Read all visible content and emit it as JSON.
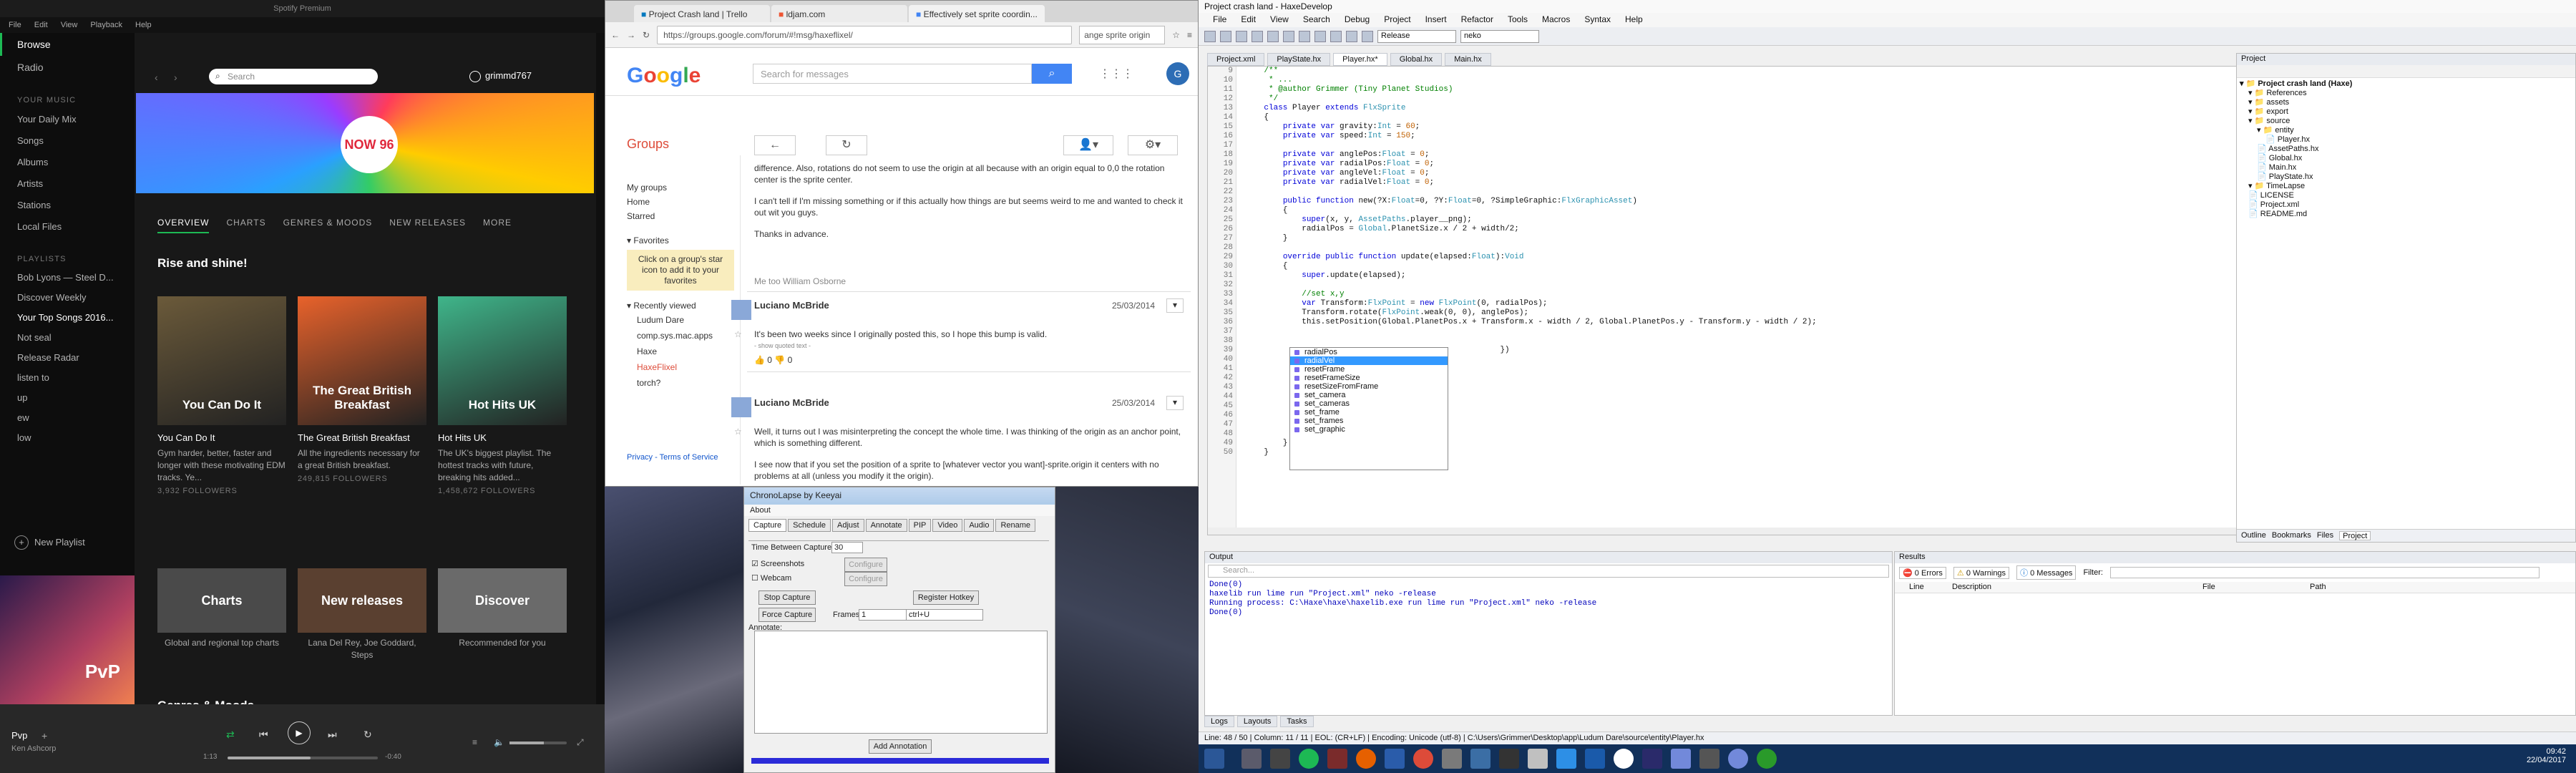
{
  "spotify": {
    "title": "Spotify Premium",
    "menu": [
      "File",
      "Edit",
      "View",
      "Playback",
      "Help"
    ],
    "nav": [
      {
        "label": "Browse",
        "on": true
      },
      {
        "label": "Radio",
        "on": false
      }
    ],
    "library_header": "YOUR MUSIC",
    "library": [
      "Your Daily Mix",
      "Songs",
      "Albums",
      "Artists",
      "Stations",
      "Local Files"
    ],
    "playlists_header": "PLAYLISTS",
    "playlists": [
      "Bob Lyons — Steel D...",
      "Discover Weekly",
      "Your Top Songs 2016...",
      "Not seal",
      "Release Radar",
      "listen to",
      "up",
      "ew",
      "low"
    ],
    "new_playlist": "New Playlist",
    "search_placeholder": "Search",
    "user": "grimmd767",
    "banner_badge": "NOW 96",
    "tabs": [
      "OVERVIEW",
      "CHARTS",
      "GENRES & MOODS",
      "NEW RELEASES",
      "MORE"
    ],
    "section1": "Rise and shine!",
    "tiles": [
      {
        "title": "You Can Do It",
        "desc": "Gym harder, better, faster and longer with these motivating EDM tracks. Ye...",
        "followers": "3,932 FOLLOWERS",
        "img": "You Can Do It",
        "c": "#6b5a3a"
      },
      {
        "title": "The Great British Breakfast",
        "desc": "All the ingredients necessary for a great British breakfast.",
        "followers": "249,815 FOLLOWERS",
        "img": "The Great British Breakfast",
        "c": "#e8622b"
      },
      {
        "title": "Hot Hits UK",
        "desc": "The UK's biggest playlist. The hottest tracks with future, breaking hits added...",
        "followers": "1,458,672 FOLLOWERS",
        "img": "Hot Hits UK",
        "c": "#3fb58a"
      }
    ],
    "tiles2": [
      {
        "title": "Charts",
        "desc": "Global and regional top charts",
        "c": "#4a4a4a"
      },
      {
        "title": "New releases",
        "desc": "Lana Del Rey, Joe Goddard, Steps",
        "c": "#5a4030"
      },
      {
        "title": "Discover",
        "desc": "Recommended for you",
        "c": "#6a6a6a"
      }
    ],
    "section2": "Genres & Moods",
    "now_playing": {
      "track": "Pvp",
      "artist": "Ken Ashcorp",
      "cover_text": "PvP",
      "elapsed": "1:13",
      "remaining": "-0:40",
      "progress": 0.55,
      "volume": 0.6
    }
  },
  "chrome": {
    "tabs": [
      "Project Crash land | Trello",
      "ldjam.com",
      "Effectively set sprite coordin..."
    ],
    "url": "https://groups.google.com/forum/#!msg/haxeflixel/",
    "search_box": "ange sprite origin",
    "search_placeholder": "Search for messages",
    "groups_title": "Groups",
    "left_links": [
      "My groups",
      "Home",
      "Starred"
    ],
    "favorites_header": "Favorites",
    "favorites_note": "Click on a group's star icon to add it to your favorites",
    "recent_header": "Recently viewed",
    "recent": [
      "Ludum Dare",
      "comp.sys.mac.apps",
      "Haxe",
      "HaxeFlixel",
      "torch?"
    ],
    "footer": "Privacy - Terms of Service",
    "post0": [
      "difference. Also, rotations do not seem to use the origin at all because with an origin equal to 0,0 the rotation center is the sprite center.",
      "I can't tell if I'm missing something or if this actually how things are but seems weird to me and wanted to check it out wit you guys.",
      "Thanks in advance."
    ],
    "metoo": "Me too William Osborne",
    "posts": [
      {
        "author": "Luciano McBride",
        "date": "25/03/2014",
        "body": "It's been two weeks since I originally posted this, so I hope this bump is valid.",
        "quoted": "- show quoted text -",
        "up": "0",
        "down": "0"
      },
      {
        "author": "Luciano McBride",
        "date": "25/03/2014",
        "body": "Well, it turns out I was misinterpreting the concept the whole time. I was thinking of the origin as an anchor point, which is something different.",
        "body2": "I see now that if you set the position of a sprite to [whatever vector you want]-sprite.origin it centers with no problems at all (unless you modify it the origin)."
      }
    ]
  },
  "chronolapse": {
    "title": "ChronoLapse by Keeyai",
    "menu": "About",
    "tabs": [
      "Capture",
      "Schedule",
      "Adjust",
      "Annotate",
      "PIP",
      "Video",
      "Audio",
      "Rename"
    ],
    "time_label": "Time Between Captures:",
    "time_value": "30",
    "screenshots": "Screenshots",
    "webcam": "Webcam",
    "configure": "Configure",
    "stop": "Stop Capture",
    "force": "Force Capture",
    "frames_label": "Frames:",
    "frames_value": "1",
    "register": "Register Hotkey",
    "hotkey": "ctrl+U",
    "annotate_label": "Annotate:",
    "add_annotation": "Add Annotation"
  },
  "ide": {
    "title": "Project crash land - HaxeDevelop",
    "menu": [
      "File",
      "Edit",
      "View",
      "Search",
      "Debug",
      "Project",
      "Insert",
      "Refactor",
      "Tools",
      "Macros",
      "Syntax",
      "Help"
    ],
    "config": "Release",
    "target": "neko",
    "file_tabs": [
      "Project.xml",
      "PlayState.hx",
      "Player.hx*",
      "Global.hx",
      "Main.hx"
    ],
    "line_start": 9,
    "code": [
      [
        [
          "    /**",
          "cm"
        ]
      ],
      [
        [
          "     * ...",
          "cm"
        ]
      ],
      [
        [
          "     * @author Grimmer (Tiny Planet Studios)",
          "cm"
        ]
      ],
      [
        [
          "     */",
          "cm"
        ]
      ],
      [
        [
          "    ",
          ""
        ],
        [
          "class ",
          "kw"
        ],
        [
          "Player ",
          ""
        ],
        [
          "extends ",
          "kw"
        ],
        [
          "FlxSprite",
          "ty"
        ]
      ],
      [
        [
          "    {",
          ""
        ]
      ],
      [
        [
          "        ",
          ""
        ],
        [
          "private var ",
          "kw"
        ],
        [
          "gravity:",
          ""
        ],
        [
          "Int",
          "ty"
        ],
        [
          " = ",
          ""
        ],
        [
          "60",
          "nm"
        ],
        [
          ";",
          ""
        ]
      ],
      [
        [
          "        ",
          ""
        ],
        [
          "private var ",
          "kw"
        ],
        [
          "speed:",
          ""
        ],
        [
          "Int",
          "ty"
        ],
        [
          " = ",
          ""
        ],
        [
          "150",
          "nm"
        ],
        [
          ";",
          ""
        ]
      ],
      [
        [
          "",
          ""
        ]
      ],
      [
        [
          "        ",
          ""
        ],
        [
          "private var ",
          "kw"
        ],
        [
          "anglePos:",
          ""
        ],
        [
          "Float",
          "ty"
        ],
        [
          " = ",
          ""
        ],
        [
          "0",
          "nm"
        ],
        [
          ";",
          ""
        ]
      ],
      [
        [
          "        ",
          ""
        ],
        [
          "private var ",
          "kw"
        ],
        [
          "radialPos:",
          ""
        ],
        [
          "Float",
          "ty"
        ],
        [
          " = ",
          ""
        ],
        [
          "0",
          "nm"
        ],
        [
          ";",
          ""
        ]
      ],
      [
        [
          "        ",
          ""
        ],
        [
          "private var ",
          "kw"
        ],
        [
          "angleVel:",
          ""
        ],
        [
          "Float",
          "ty"
        ],
        [
          " = ",
          ""
        ],
        [
          "0",
          "nm"
        ],
        [
          ";",
          ""
        ]
      ],
      [
        [
          "        ",
          ""
        ],
        [
          "private var ",
          "kw"
        ],
        [
          "radialVel:",
          ""
        ],
        [
          "Float",
          "ty"
        ],
        [
          " = ",
          ""
        ],
        [
          "0",
          "nm"
        ],
        [
          ";",
          ""
        ]
      ],
      [
        [
          "",
          ""
        ]
      ],
      [
        [
          "        ",
          ""
        ],
        [
          "public function ",
          "kw"
        ],
        [
          "new(?X:",
          ""
        ],
        [
          "Float",
          "ty"
        ],
        [
          "=0, ?Y:",
          ""
        ],
        [
          "Float",
          "ty"
        ],
        [
          "=0, ?SimpleGraphic:",
          ""
        ],
        [
          "FlxGraphicAsset",
          "ty"
        ],
        [
          ")",
          ""
        ]
      ],
      [
        [
          "        {",
          ""
        ]
      ],
      [
        [
          "            ",
          ""
        ],
        [
          "super",
          "kw"
        ],
        [
          "(x, y, ",
          ""
        ],
        [
          "AssetPaths",
          "ty"
        ],
        [
          ".player__png);",
          ""
        ]
      ],
      [
        [
          "            radialPos = ",
          ""
        ],
        [
          "Global",
          "ty"
        ],
        [
          ".PlanetSize.x / 2 + width/2;",
          ""
        ]
      ],
      [
        [
          "        }",
          ""
        ]
      ],
      [
        [
          "",
          ""
        ]
      ],
      [
        [
          "        ",
          ""
        ],
        [
          "override public function ",
          "kw"
        ],
        [
          "update(elapsed:",
          ""
        ],
        [
          "Float",
          "ty"
        ],
        [
          "):",
          ""
        ],
        [
          "Void",
          "ty"
        ]
      ],
      [
        [
          "        {",
          ""
        ]
      ],
      [
        [
          "            ",
          ""
        ],
        [
          "super",
          "kw"
        ],
        [
          ".update(elapsed);",
          ""
        ]
      ],
      [
        [
          "",
          ""
        ]
      ],
      [
        [
          "            //set x,y",
          "cm"
        ]
      ],
      [
        [
          "            ",
          ""
        ],
        [
          "var ",
          "kw"
        ],
        [
          "Transform:",
          ""
        ],
        [
          "FlxPoint",
          "ty"
        ],
        [
          " = ",
          ""
        ],
        [
          "new ",
          "kw"
        ],
        [
          "FlxPoint",
          "ty"
        ],
        [
          "(0, radialPos);",
          ""
        ]
      ],
      [
        [
          "            Transform.rotate(",
          ""
        ],
        [
          "FlxPoint",
          "ty"
        ],
        [
          ".weak(0, 0), anglePos);",
          ""
        ]
      ],
      [
        [
          "            this.setPosition(Global.PlanetPos.x + Transform.x - width / 2, Global.PlanetPos.y - Transform.y - width / 2);",
          ""
        ]
      ],
      [
        [
          "",
          ""
        ]
      ],
      [
        [
          "",
          ""
        ]
      ],
      [
        [
          "                                                      })",
          ""
        ]
      ],
      [
        [
          "",
          ""
        ]
      ],
      [
        [
          "",
          ""
        ]
      ],
      [
        [
          "",
          ""
        ]
      ],
      [
        [
          "",
          ""
        ]
      ],
      [
        [
          "",
          ""
        ]
      ],
      [
        [
          "",
          ""
        ]
      ],
      [
        [
          "",
          ""
        ]
      ],
      [
        [
          "",
          ""
        ]
      ],
      [
        [
          "            ra",
          ""
        ]
      ],
      [
        [
          "        }",
          ""
        ]
      ],
      [
        [
          "    }",
          ""
        ]
      ]
    ],
    "autocomplete": [
      "radialPos",
      "radialVel",
      "resetFrame",
      "resetFrameSize",
      "resetSizeFromFrame",
      "set_camera",
      "set_cameras",
      "set_frame",
      "set_frames",
      "set_graphic"
    ],
    "autocomplete_selected": 1,
    "project_header": "Project",
    "tree": [
      {
        "t": "Project crash land (Haxe)",
        "d": 0,
        "b": true
      },
      {
        "t": "References",
        "d": 1
      },
      {
        "t": "assets",
        "d": 1
      },
      {
        "t": "export",
        "d": 1
      },
      {
        "t": "source",
        "d": 1
      },
      {
        "t": "entity",
        "d": 2
      },
      {
        "t": "Player.hx",
        "d": 3
      },
      {
        "t": "AssetPaths.hx",
        "d": 2
      },
      {
        "t": "Global.hx",
        "d": 2
      },
      {
        "t": "Main.hx",
        "d": 2
      },
      {
        "t": "PlayState.hx",
        "d": 2
      },
      {
        "t": "TimeLapse",
        "d": 1
      },
      {
        "t": "LICENSE",
        "d": 1
      },
      {
        "t": "Project.xml",
        "d": 1
      },
      {
        "t": "README.md",
        "d": 1
      }
    ],
    "side_tabs": [
      "Outline",
      "Bookmarks",
      "Files",
      "Project"
    ],
    "output_header": "Output",
    "output_search": "Search...",
    "output": [
      "Done(0)",
      "haxelib run lime run \"Project.xml\" neko -release",
      "Running process: C:\\Haxe\\haxe\\haxelib.exe run lime run \"Project.xml\" neko -release",
      "Done(0)"
    ],
    "results_header": "Results",
    "errors": "0 Errors",
    "warnings": "0 Warnings",
    "messages": "0 Messages",
    "filter": "Filter:",
    "cols": [
      "Line",
      "Description",
      "File",
      "Path"
    ],
    "bottom_tabs": [
      "Logs",
      "Layouts",
      "Tasks"
    ],
    "status": "Line: 48 / 50  |  Column: 11 / 11  |  EOL: (CR+LF)  |  Encoding: Unicode (utf-8)  |  C:\\Users\\Grimmer\\Desktop\\app\\Ludum Dare\\source\\entity\\Player.hx",
    "clock_time": "09:42",
    "clock_date": "22/04/2017"
  },
  "colors": {
    "spotify_green": "#1db954",
    "google_blue": "#4285f4",
    "groups_red": "#dd4b39"
  }
}
